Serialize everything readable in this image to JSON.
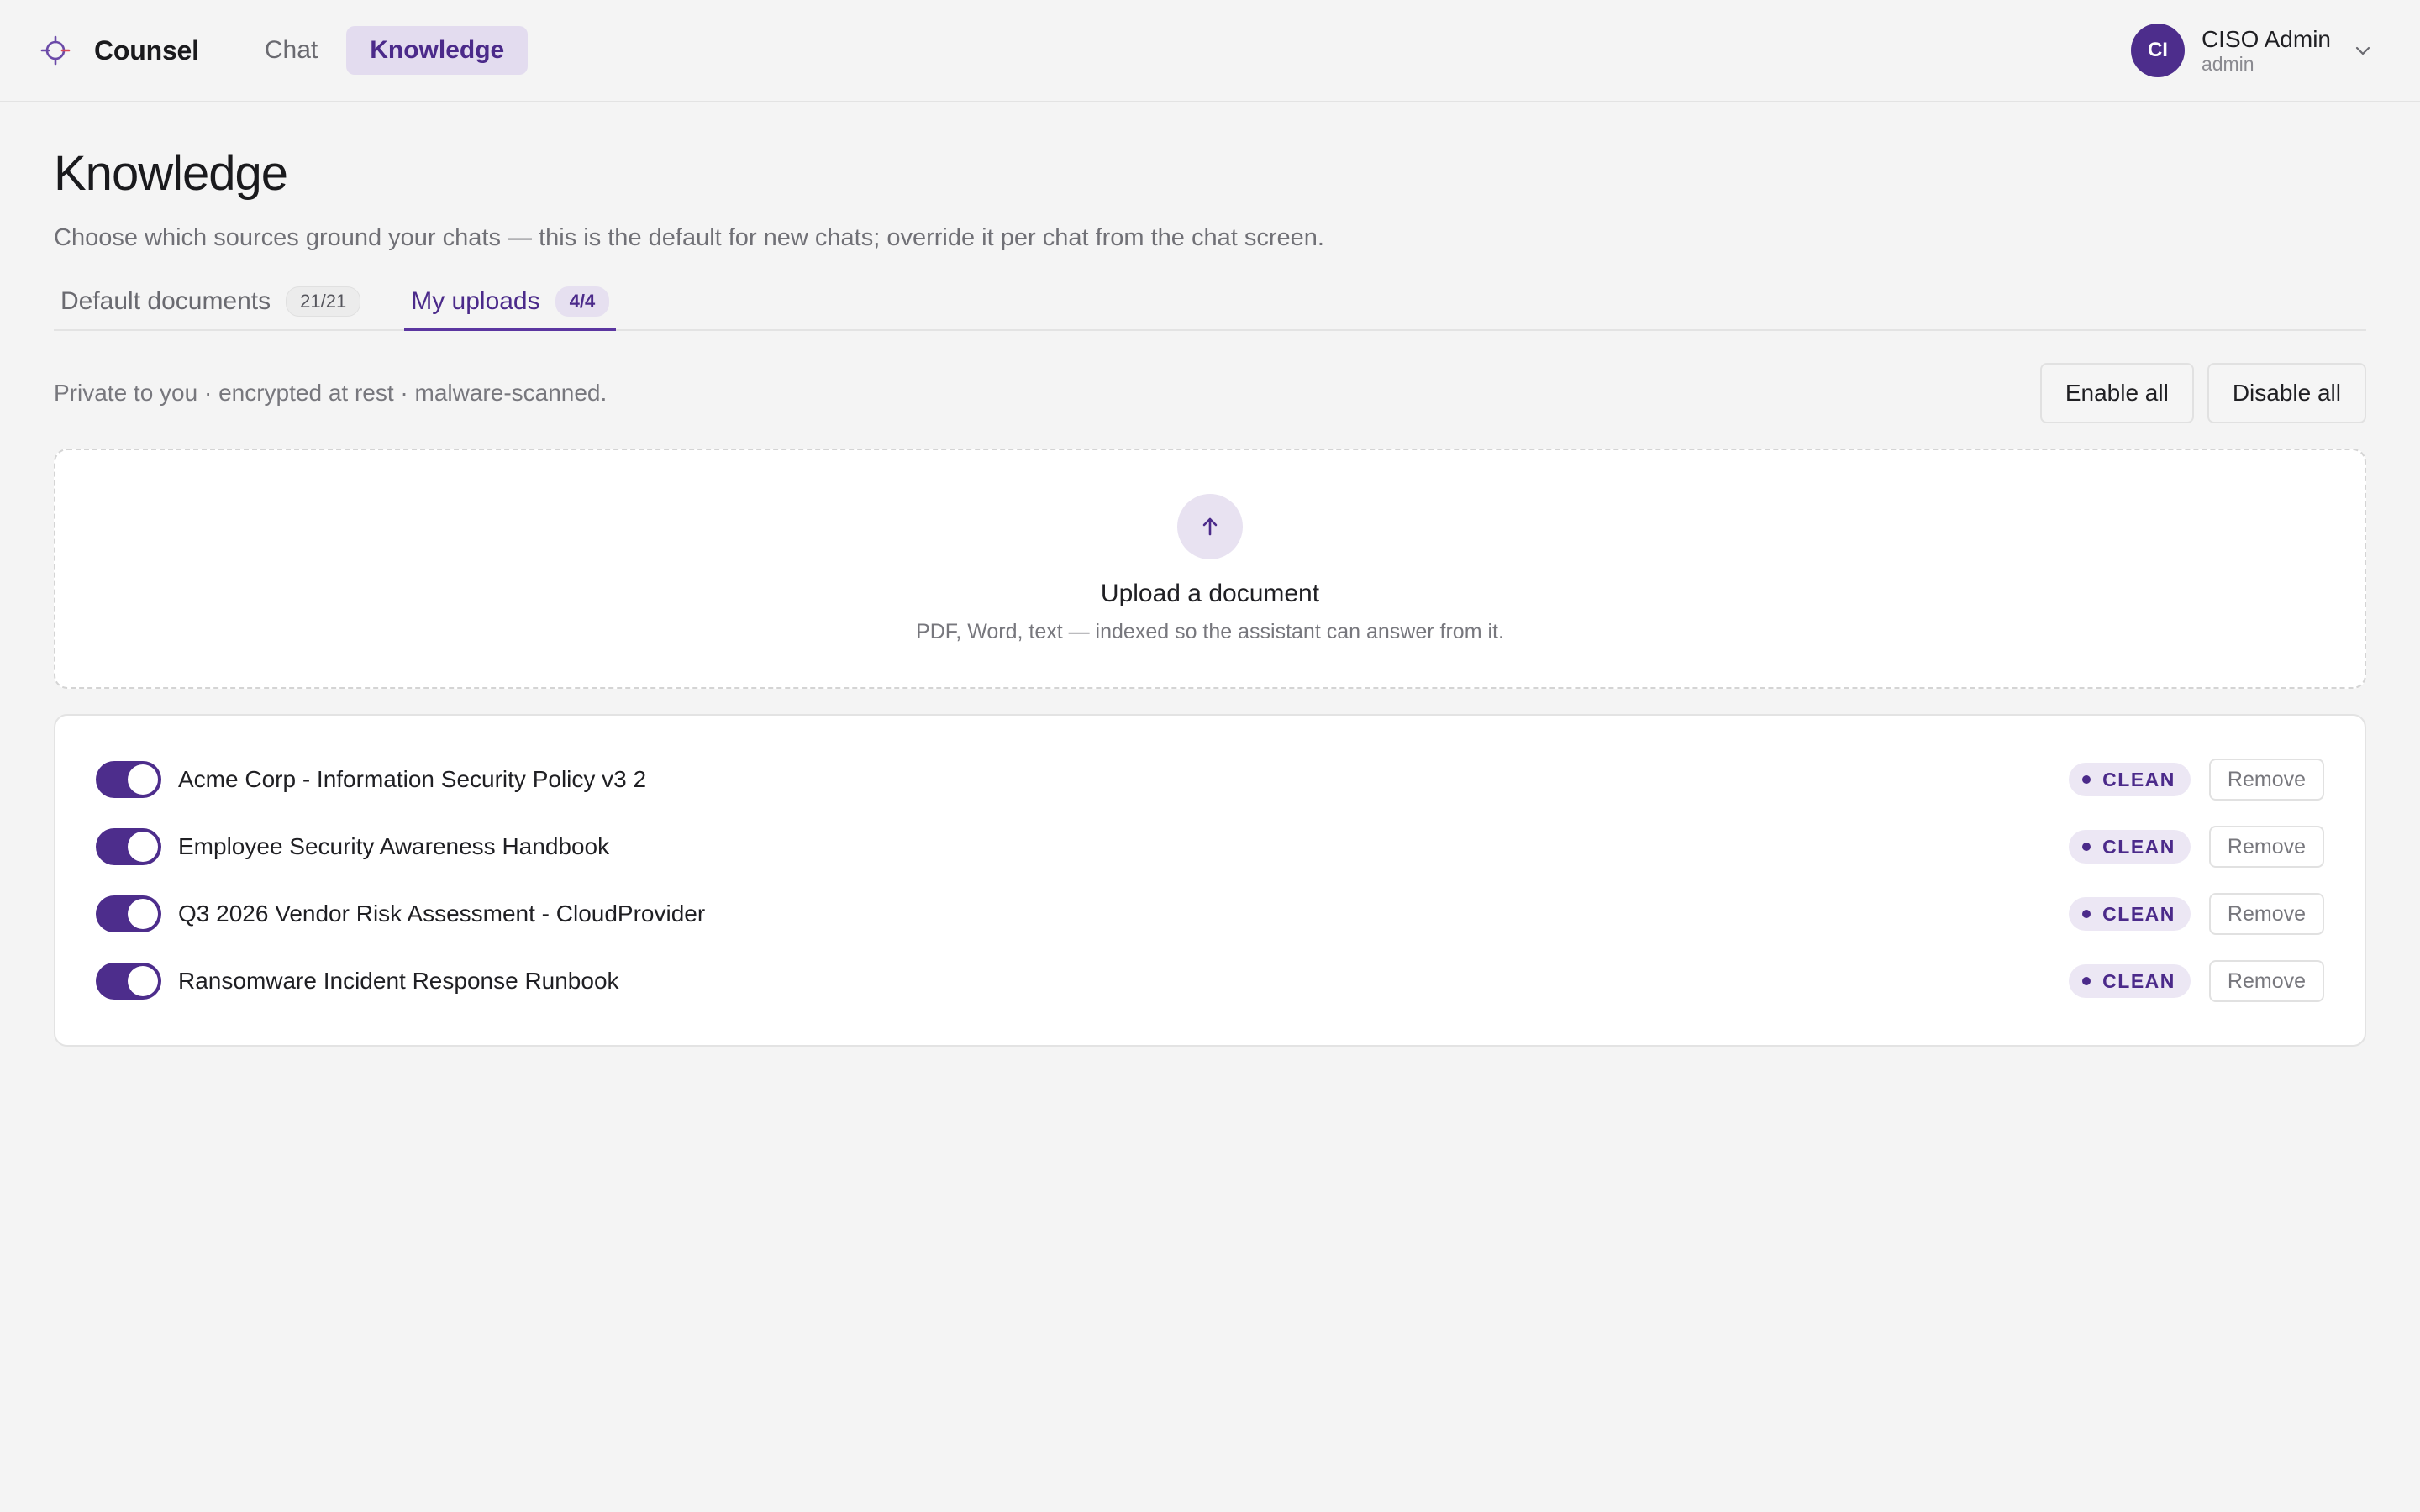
{
  "header": {
    "brand": "Counsel",
    "nav": [
      {
        "label": "Chat",
        "active": false
      },
      {
        "label": "Knowledge",
        "active": true
      }
    ],
    "user": {
      "initials": "CI",
      "name": "CISO Admin",
      "role": "admin"
    },
    "colors": {
      "accent": "#4d2d8c"
    }
  },
  "page": {
    "title": "Knowledge",
    "subtitle": "Choose which sources ground your chats — this is the default for new chats; override it per chat from the chat screen."
  },
  "tabs": [
    {
      "label": "Default documents",
      "count": "21/21",
      "active": false
    },
    {
      "label": "My uploads",
      "count": "4/4",
      "active": true
    }
  ],
  "toolbar": {
    "privacy_note": "Private to you · encrypted at rest · malware-scanned.",
    "enable_all": "Enable all",
    "disable_all": "Disable all"
  },
  "upload": {
    "icon": "arrow-up-icon",
    "title": "Upload a document",
    "subtitle": "PDF, Word, text — indexed so the assistant can answer from it."
  },
  "documents": [
    {
      "name": "Acme Corp - Information Security Policy v3 2",
      "enabled": true,
      "status": "CLEAN",
      "remove_label": "Remove"
    },
    {
      "name": "Employee Security Awareness Handbook",
      "enabled": true,
      "status": "CLEAN",
      "remove_label": "Remove"
    },
    {
      "name": "Q3 2026 Vendor Risk Assessment - CloudProvider",
      "enabled": true,
      "status": "CLEAN",
      "remove_label": "Remove"
    },
    {
      "name": "Ransomware Incident Response Runbook",
      "enabled": true,
      "status": "CLEAN",
      "remove_label": "Remove"
    }
  ]
}
